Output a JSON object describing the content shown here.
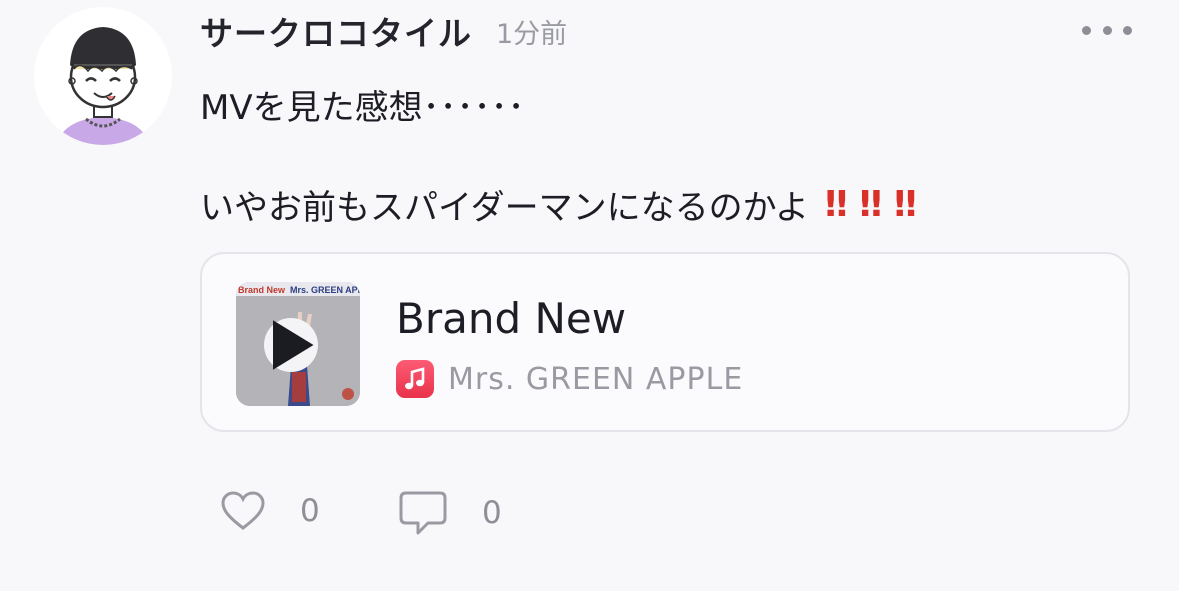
{
  "post": {
    "user_name": "サークロコタイル",
    "timestamp": "1分前",
    "text_line1": "MVを見た感想･･････",
    "text_line2": "いやお前もスパイダーマンになるのかよ",
    "exclaims": [
      "‼",
      "‼",
      "‼"
    ]
  },
  "music_card": {
    "title": "Brand New",
    "artist": "Mrs. GREEN APPLE",
    "artwork_text_left": "Brand New",
    "artwork_text_right": "Mrs. GREEN APPLE"
  },
  "actions": {
    "like_count": "0",
    "comment_count": "0"
  },
  "colors": {
    "accent_exclaim": "#d9302a",
    "apple_music": "#f0445c"
  }
}
